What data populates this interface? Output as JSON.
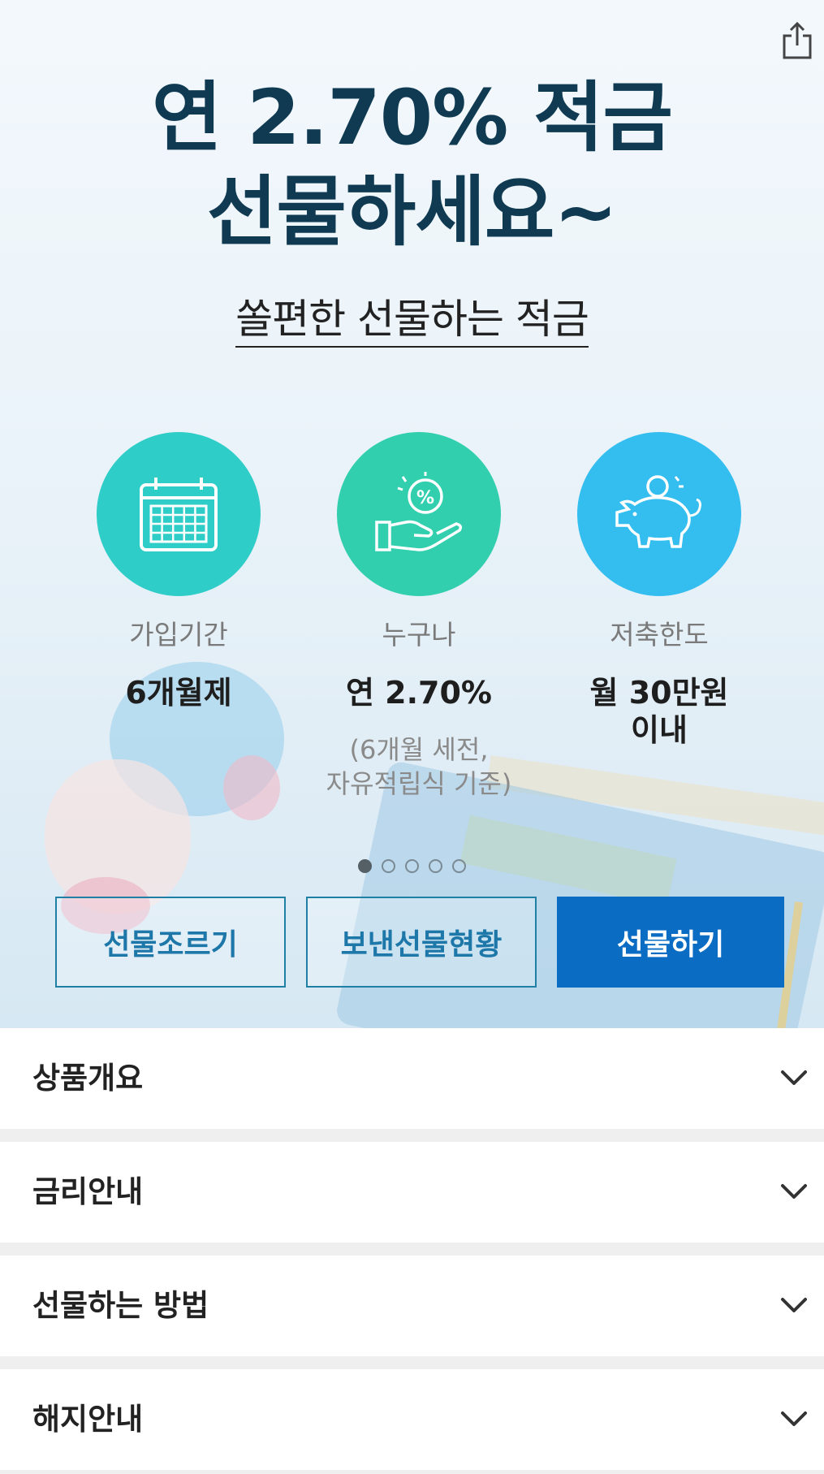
{
  "hero": {
    "title_line1": "연 2.70% 적금",
    "title_line2": "선물하세요~",
    "subtitle": "쏠편한 선물하는 적금",
    "features": [
      {
        "icon": "calendar-icon",
        "color": "#2fcdc8",
        "label": "가입기간",
        "value": "6개월제"
      },
      {
        "icon": "percent-hand-icon",
        "color": "#32cfae",
        "label": "누구나",
        "value": "연 2.70%",
        "note_line1": "(6개월 세전,",
        "note_line2": "자유적립식 기준)"
      },
      {
        "icon": "piggy-bank-icon",
        "color": "#34bef0",
        "label": "저축한도",
        "value_line1": "월 30만원",
        "value_line2": "이내"
      }
    ],
    "pagination": {
      "total": 5,
      "current": 1
    }
  },
  "actions": {
    "request_gift_label": "선물조르기",
    "sent_gifts_label": "보낸선물현황",
    "give_gift_label": "선물하기"
  },
  "accordion": {
    "items": [
      {
        "label": "상품개요"
      },
      {
        "label": "금리안내"
      },
      {
        "label": "선물하는 방법"
      },
      {
        "label": "해지안내"
      }
    ]
  },
  "colors": {
    "title": "#0f3a52",
    "primary_button": "#0b6cc4",
    "outline_button": "#1f7fa4"
  }
}
